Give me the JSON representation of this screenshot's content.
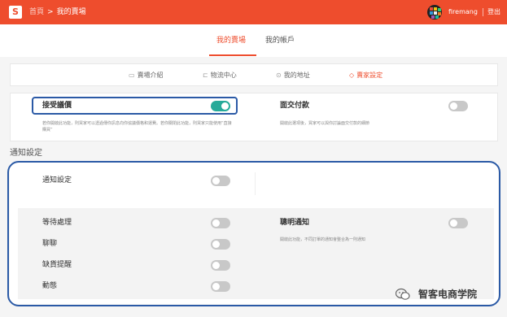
{
  "header": {
    "logo_glyph": "S",
    "breadcrumb_home": "首頁",
    "breadcrumb_sep": ">",
    "breadcrumb_current": "我的賣場",
    "username": "firemang",
    "logout": "登出",
    "bg_color": "#ee4d2d"
  },
  "tabs": [
    {
      "label": "我的賣場",
      "active": true
    },
    {
      "label": "我的帳戶",
      "active": false
    }
  ],
  "subnav": [
    {
      "icon": "shop-icon",
      "glyph": "▭",
      "label": "賣場介紹"
    },
    {
      "icon": "truck-icon",
      "glyph": "⊏",
      "label": "物流中心"
    },
    {
      "icon": "location-pin-icon",
      "glyph": "⊙",
      "label": "我的地址"
    },
    {
      "icon": "tag-icon",
      "glyph": "◇",
      "label": "賣家設定",
      "active": true
    }
  ],
  "settings": {
    "accept_offer": {
      "title": "接受議價",
      "enabled": true,
      "desc": "若你開啟此功能，則買家可以透過傳你訊息向你協議價格和運費。若你關閉此功能，則買家只能使用“直接購買”"
    },
    "meetup_payment": {
      "title": "面交付款",
      "enabled": false,
      "desc": "開啟此選項後，買家可以與你討論面交付款的細節"
    }
  },
  "notifications": {
    "section_title": "通知設定",
    "master": {
      "label": "通知設定",
      "enabled": false
    },
    "items": [
      {
        "label": "等待處理",
        "enabled": false
      },
      {
        "label": "聊聊",
        "enabled": false
      },
      {
        "label": "缺貨提醒",
        "enabled": false
      },
      {
        "label": "動態",
        "enabled": false
      }
    ],
    "smart": {
      "label": "聰明通知",
      "enabled": false,
      "desc": "開啟此功能，不同訂單的通知會整合為一則通知"
    }
  },
  "watermark": {
    "text": "智客电商学院"
  }
}
